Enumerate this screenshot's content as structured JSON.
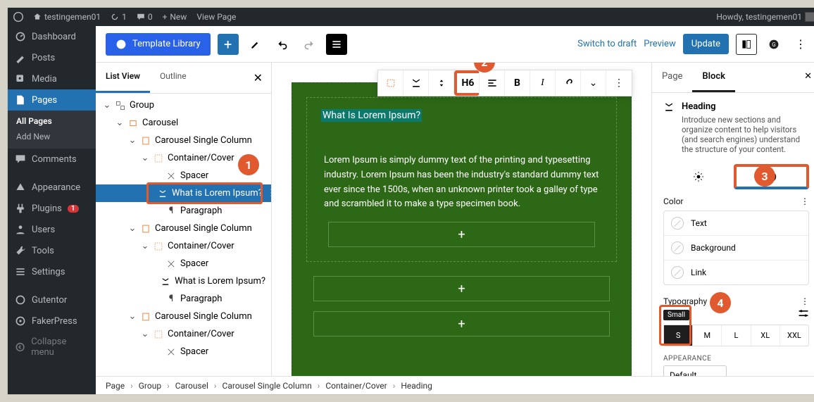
{
  "adminbar": {
    "site": "testingemen01",
    "updates_count": "1",
    "comments_count": "0",
    "new_label": "New",
    "view_label": "View Page",
    "howdy": "Howdy, testingemen01"
  },
  "wpmenu": {
    "dashboard": "Dashboard",
    "posts": "Posts",
    "media": "Media",
    "pages": "Pages",
    "all_pages": "All Pages",
    "add_new": "Add New",
    "comments": "Comments",
    "appearance": "Appearance",
    "plugins": "Plugins",
    "plugins_badge": "1",
    "users": "Users",
    "tools": "Tools",
    "settings": "Settings",
    "gutentor": "Gutentor",
    "fakerpress": "FakerPress",
    "collapse": "Collapse menu"
  },
  "editor_top": {
    "template_library": "Template Library",
    "switch_draft": "Switch to draft",
    "preview": "Preview",
    "update": "Update"
  },
  "listpanel": {
    "tab_list": "List View",
    "tab_outline": "Outline"
  },
  "tree": {
    "group": "Group",
    "carousel": "Carousel",
    "csc": "Carousel Single Column",
    "container": "Container/Cover",
    "spacer": "Spacer",
    "heading_item": "What is Lorem Ipsum?",
    "paragraph": "Paragraph"
  },
  "canvas": {
    "heading": "What Is Lorem Ipsum?",
    "paragraph": "Lorem Ipsum is simply dummy text of the printing and typesetting industry. Lorem Ipsum has been the industry's standard dummy text ever since the 1500s, when an unknown printer took a galley of type and scrambled it to make a type specimen book."
  },
  "toolbar": {
    "h": "H6",
    "b": "B",
    "i": "I"
  },
  "settings": {
    "tab_page": "Page",
    "tab_block": "Block",
    "block_name": "Heading",
    "block_desc": "Introduce new sections and organize content to help visitors (and search engines) understand the structure of your content.",
    "color_hdr": "Color",
    "color_text": "Text",
    "color_bg": "Background",
    "color_link": "Link",
    "typo_hdr": "Typography",
    "chip": "Small",
    "sizes": {
      "s": "S",
      "m": "M",
      "l": "L",
      "xl": "XL",
      "xxl": "XXL"
    },
    "appearance": "APPEARANCE",
    "default": "Default"
  },
  "breadcrumb": [
    "Page",
    "Group",
    "Carousel",
    "Carousel Single Column",
    "Container/Cover",
    "Heading"
  ],
  "annotations": {
    "a1": "1",
    "a2": "2",
    "a3": "3",
    "a4": "4"
  }
}
